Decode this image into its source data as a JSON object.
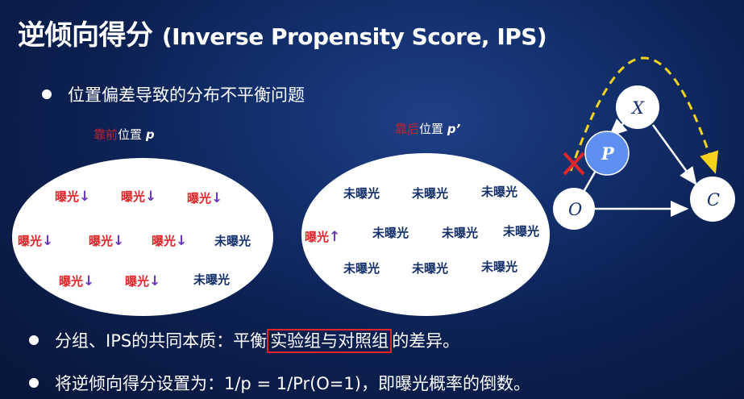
{
  "title": {
    "cn": "逆倾向得分",
    "en": "(Inverse Propensity Score, IPS)"
  },
  "bullets": [
    "位置偏差导致的分布不平衡问题",
    "分组、IPS的共同本质：平衡",
    "实验组与对照组",
    "的差异。",
    "将逆倾向得分设置为：1/p = 1/Pr(O=1)，即曝光概率的倒数。"
  ],
  "left_caption": {
    "pos": "靠前",
    "text": "位置",
    "var": "p"
  },
  "right_caption": {
    "pos": "靠后",
    "text": "位置",
    "var": "p’"
  },
  "labels": {
    "exposed": "曝光",
    "unexposed": "未曝光",
    "down": "↓",
    "up": "↑"
  },
  "left_items": [
    {
      "t": "e"
    },
    {
      "t": "e"
    },
    {
      "t": "e"
    },
    {
      "t": "e"
    },
    {
      "t": "e"
    },
    {
      "t": "e"
    },
    {
      "t": "u"
    },
    {
      "t": "e"
    },
    {
      "t": "e"
    },
    {
      "t": "u"
    }
  ],
  "right_items": [
    {
      "t": "u"
    },
    {
      "t": "u"
    },
    {
      "t": "u"
    },
    {
      "t": "e"
    },
    {
      "t": "u"
    },
    {
      "t": "u"
    },
    {
      "t": "u"
    },
    {
      "t": "u"
    },
    {
      "t": "u"
    },
    {
      "t": "u"
    }
  ],
  "diagram": {
    "nodes": {
      "X": "X",
      "P": "P",
      "O": "O",
      "C": "C"
    }
  },
  "colors": {
    "accent_yellow": "#f2d21c",
    "red": "#e0262a",
    "p_node": "#5f8ff0",
    "navy": "#14306a"
  }
}
